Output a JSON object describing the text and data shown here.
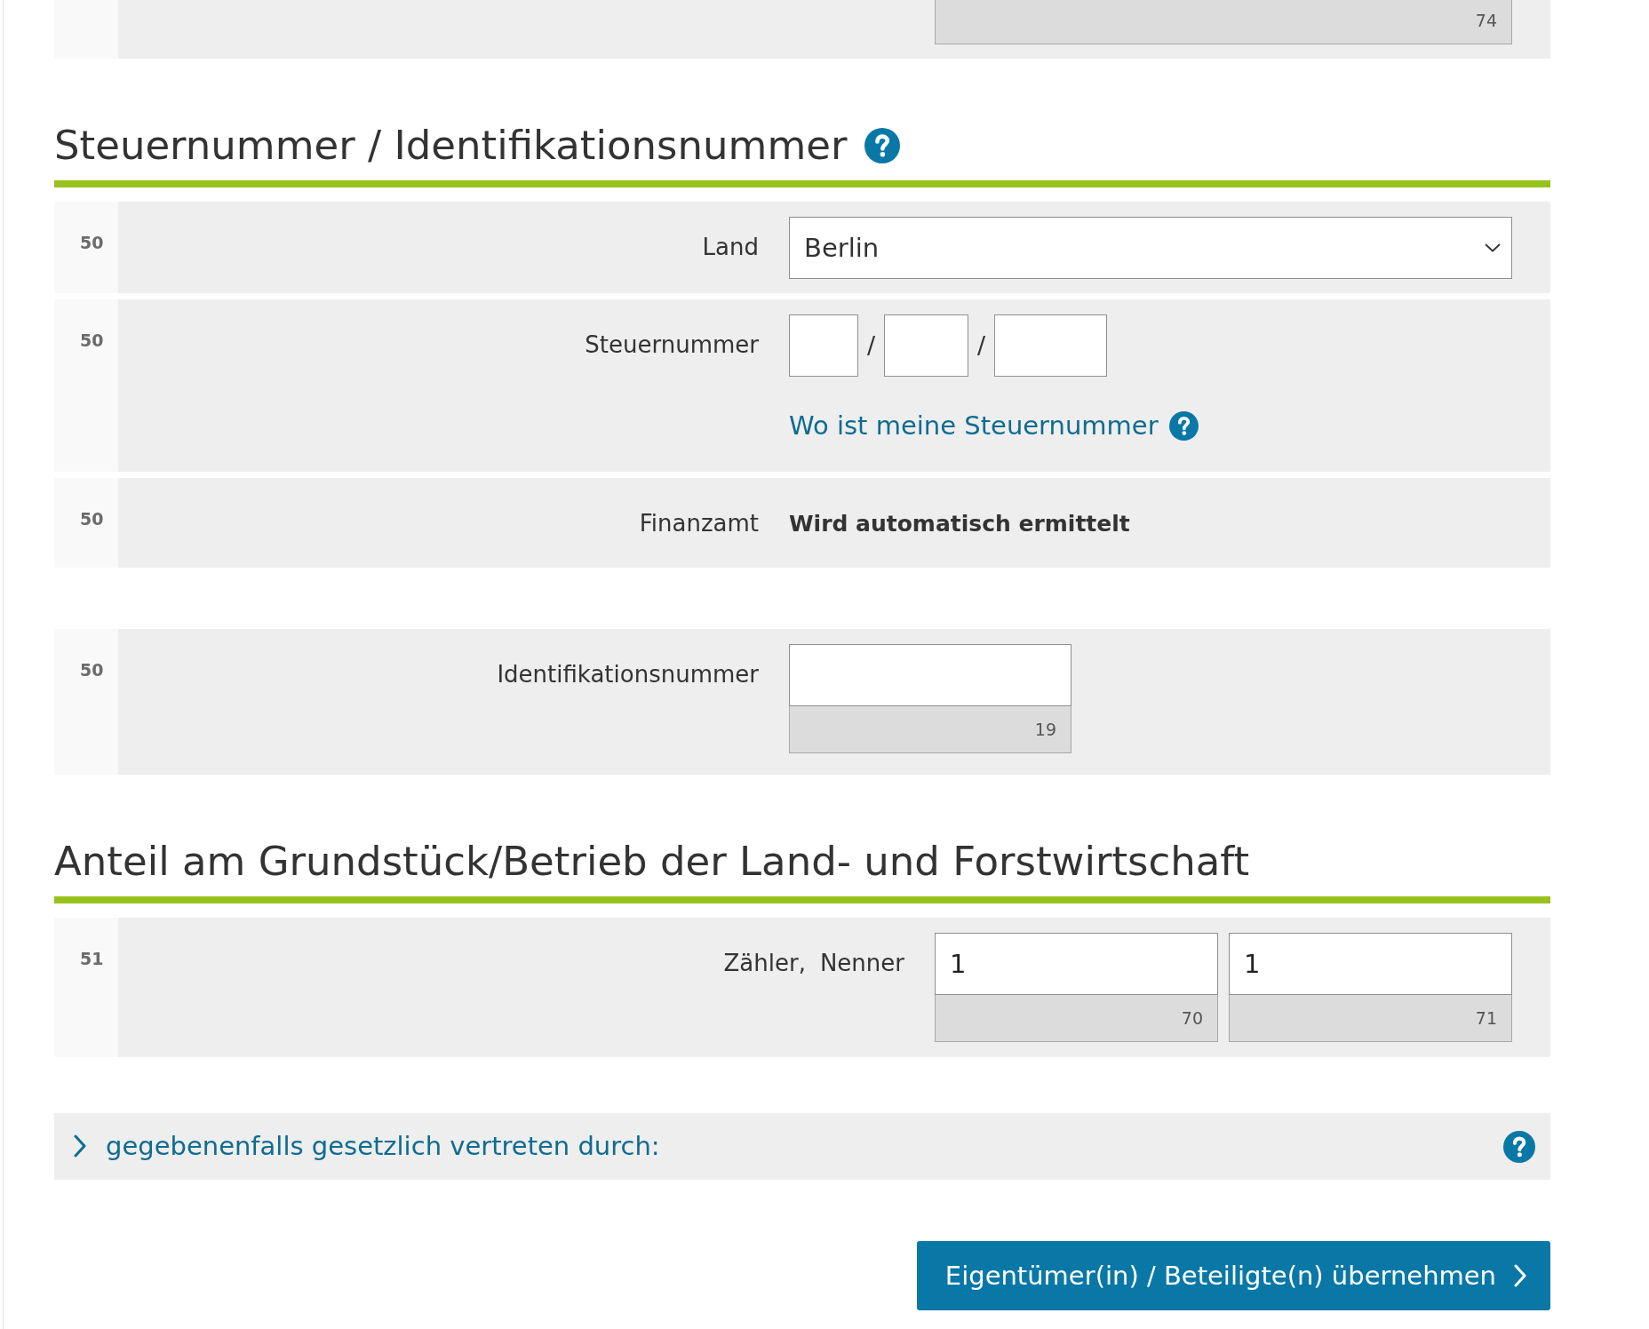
{
  "partial_row": {
    "code": "74"
  },
  "sections": [
    {
      "title": "Steuernummer / Identifikationsnummer",
      "help": true,
      "groups": [
        {
          "rows": [
            {
              "kind": "select",
              "line": "50",
              "labels": [
                "Land"
              ],
              "value": "Berlin"
            },
            {
              "kind": "tax-number",
              "line": "50",
              "labels": [
                "Steuernummer"
              ],
              "parts": [
                {
                  "kind": "input"
                },
                {
                  "kind": "slash",
                  "text": "/"
                },
                {
                  "kind": "input"
                },
                {
                  "kind": "slash",
                  "text": "/"
                },
                {
                  "kind": "input"
                }
              ],
              "link": {
                "text": "Wo ist meine Steuernummer",
                "help": true
              }
            },
            {
              "kind": "static",
              "line": "50",
              "labels": [
                "Finanzamt"
              ],
              "value": "Wird automatisch ermittelt"
            }
          ]
        },
        {
          "rows": [
            {
              "kind": "coded",
              "line": "50",
              "labels": [
                "Identifikationsnummer"
              ],
              "inputs": [
                {
                  "code": "19"
                }
              ]
            }
          ]
        }
      ]
    },
    {
      "title": "Anteil am Grundstück/Betrieb der Land- und Forstwirtschaft",
      "help": false,
      "groups": [
        {
          "rows": [
            {
              "kind": "ratio",
              "line": "51",
              "labels": [
                "Zähler,",
                "Nenner"
              ],
              "inputs": [
                {
                  "value": "1",
                  "code": "70"
                },
                {
                  "value": "1",
                  "code": "71"
                }
              ]
            }
          ]
        }
      ]
    }
  ],
  "collapsible": {
    "label": "gegebenenfalls gesetzlich vertreten durch:",
    "expanded": false,
    "help": true
  },
  "submit_button": {
    "label": "Eigentümer(in) / Beteiligte(n) übernehmen"
  }
}
